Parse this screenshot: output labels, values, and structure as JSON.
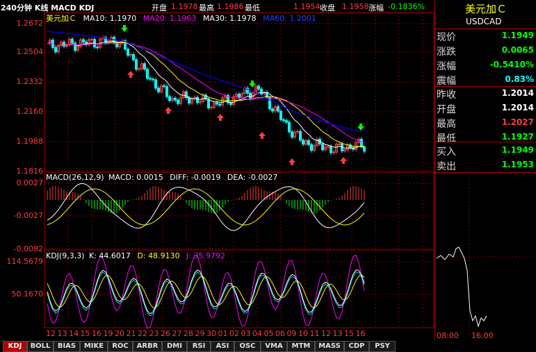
{
  "title": "240分钟 K线 MACD KDJ",
  "topbar": {
    "open_label": "开盘",
    "open_value": "1.1978",
    "high_label": "最高",
    "high_value": "1.1986",
    "low_label": "最低",
    "low_value": "1.1954",
    "close_label": "收盘",
    "close_value": "1.1958",
    "chg_label": "涨幅",
    "chg_value": "-0.1836%"
  },
  "main_legend": {
    "name": "美元加Ｃ",
    "ma10": "MA10: 1.1970",
    "ma20": "MA20: 1.1963",
    "ma30": "MA30: 1.1978",
    "ma60": "MA60: 1.2001"
  },
  "price_axis": [
    "1.2672",
    "1.2504",
    "1.2332",
    "1.2160",
    "1.1988",
    "1.1816"
  ],
  "macd_legend": {
    "name": "MACD(26,12,9)",
    "macd": "MACD: 0.0015",
    "diff": "DIFF: -0.0019",
    "dea": "DEA: -0.0027"
  },
  "macd_axis": [
    "0.0027",
    "-0.0027",
    "-0.0082"
  ],
  "kdj_legend": {
    "name": "KDJ(9,3,3)",
    "k": "K: 44.6017",
    "d": "D: 48.9130",
    "j": "J: 35.9792"
  },
  "kdj_axis": [
    "114.5679",
    "50.1670"
  ],
  "x_axis": [
    "12",
    "13",
    "14",
    "15",
    "16",
    "19",
    "20",
    "21",
    "22",
    "23",
    "26",
    "27",
    "28",
    "29",
    "30",
    "01",
    "02",
    "03",
    "04",
    "05",
    "06",
    "09",
    "10",
    "11",
    "12",
    "13",
    "15",
    "16"
  ],
  "quote": {
    "name": "美元加Ｃ",
    "code": "USDCAD",
    "rows": [
      {
        "label": "现价",
        "value": "1.1949",
        "color": "#00ff00"
      },
      {
        "label": "涨跌",
        "value": "0.0065",
        "color": "#00ff00"
      },
      {
        "label": "涨幅",
        "value": "-0.5410%",
        "color": "#00ff00"
      },
      {
        "label": "震幅",
        "value": "0.83%",
        "color": "#00ffff"
      },
      {
        "label": "昨收",
        "value": "1.2014",
        "color": "#ffffff"
      },
      {
        "label": "开盘",
        "value": "1.2014",
        "color": "#ffffff"
      },
      {
        "label": "最高",
        "value": "1.2027",
        "color": "#ff3c3c"
      },
      {
        "label": "最低",
        "value": "1.1927",
        "color": "#00ff00"
      },
      {
        "label": "买入",
        "value": "1.1949",
        "color": "#00ff00"
      },
      {
        "label": "卖出",
        "value": "1.1953",
        "color": "#00ff00"
      }
    ],
    "intraday_times": [
      "08:00",
      "16:00"
    ]
  },
  "tabs": [
    "KDJ",
    "BOLL",
    "BIAS",
    "MIKE",
    "ROC",
    "ARBR",
    "DMI",
    "RSI",
    "ASI",
    "OSC",
    "VMA",
    "MTM",
    "MASS",
    "CDP",
    "PSY"
  ],
  "active_tab": "KDJ",
  "colors": {
    "grid": "#800000",
    "up": "#ff3c3c",
    "down": "#00ffff",
    "ma10": "#ffffff",
    "ma20": "#ffff00",
    "ma30": "#ff00ff",
    "ma60": "#0000ff"
  }
}
